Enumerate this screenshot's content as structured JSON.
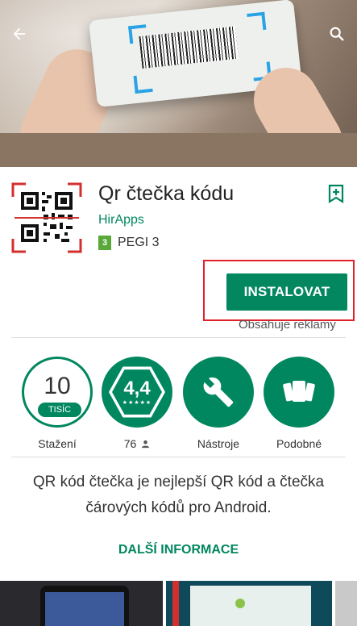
{
  "header": {
    "back_icon": "arrow-left-icon",
    "search_icon": "search-icon"
  },
  "app": {
    "title": "Qr čtečka kódu",
    "developer": "HirApps",
    "pegi_badge": "3",
    "pegi_label": "PEGI 3",
    "install_label": "INSTALOVAT",
    "ads_note": "Obsahuje reklamy",
    "icon_caption": "QR"
  },
  "stats": [
    {
      "value": "10",
      "tag": "TISÍC",
      "label": "Stažení"
    },
    {
      "value": "4,4",
      "stars": "★★★★★",
      "label": "76"
    },
    {
      "label": "Nástroje",
      "icon": "wrench-icon"
    },
    {
      "label": "Podobné",
      "icon": "cards-icon"
    }
  ],
  "description": "QR kód čtečka je nejlepší QR kód a čtečka čárových kódů pro Android.",
  "more_info": "DALŠÍ INFORMACE",
  "colors": {
    "accent": "#01875f",
    "highlight": "#e0202a"
  }
}
